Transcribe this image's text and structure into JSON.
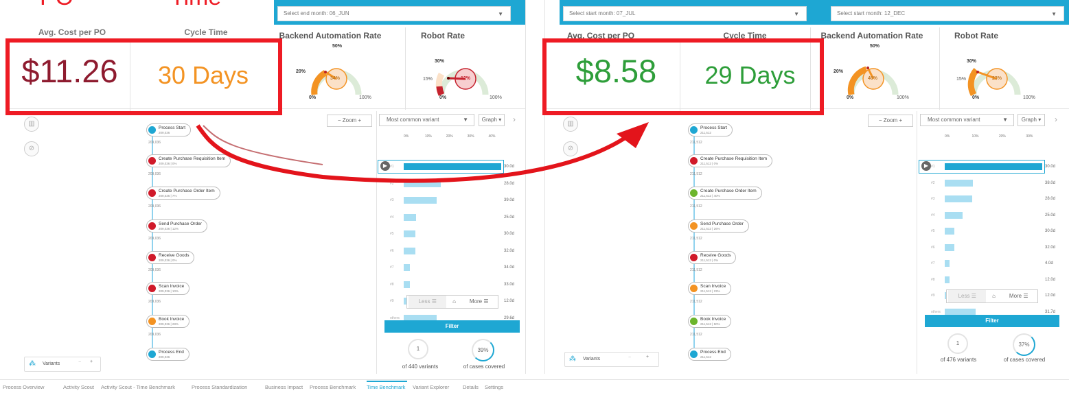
{
  "title_fragment": {
    "left": "PO",
    "right": "Time"
  },
  "left": {
    "select_label": "Select end month: 06_JUN",
    "kpi_partial": {
      "cost_header": "Avg. Cost per PO",
      "cycle_header": "Cycle Time"
    },
    "kpi": {
      "backend_header": "Backend Automation Rate",
      "robot_header": "Robot Rate",
      "avg_cost": "$11.26",
      "cycle_time": "30 Days"
    },
    "gauge_backend": {
      "value": "34%",
      "level": 0.34,
      "t0": "0%",
      "t20": "20%",
      "t50": "50%",
      "t100": "100%"
    },
    "gauge_robot": {
      "value": "12%",
      "level": 0.12,
      "t0": "0%",
      "t15": "15%",
      "t30": "30%",
      "t100": "100%"
    },
    "zoom": "Zoom",
    "variant_select": "Most common variant",
    "graph_btn": "Graph",
    "axis": [
      "0%",
      "10%",
      "20%",
      "30%",
      "40%"
    ],
    "bars": [
      {
        "label": "#1",
        "value": "30.0d",
        "frac": 1.0
      },
      {
        "label": "#2",
        "value": "28.0d",
        "frac": 0.38
      },
      {
        "label": "#3",
        "value": "39.0d",
        "frac": 0.34
      },
      {
        "label": "#4",
        "value": "25.0d",
        "frac": 0.13
      },
      {
        "label": "#5",
        "value": "30.0d",
        "frac": 0.12
      },
      {
        "label": "#6",
        "value": "32.0d",
        "frac": 0.12
      },
      {
        "label": "#7",
        "value": "34.0d",
        "frac": 0.06
      },
      {
        "label": "#8",
        "value": "33.0d",
        "frac": 0.06
      },
      {
        "label": "#9",
        "value": "12.0d",
        "frac": 0.06
      },
      {
        "label": "others",
        "value": "29.6d",
        "frac": 0.34
      }
    ],
    "less": "Less",
    "more": "More",
    "filter": "Filter",
    "variants_count": "1",
    "variants_caption": "of 440 variants",
    "cases_pct": "39%",
    "cases_caption": "of cases covered",
    "variants_btn": "Variants",
    "nodes": [
      {
        "label": "Process Start",
        "sub": "209,036",
        "color": "#1ea7d3"
      },
      {
        "label": "Create Purchase Requisition Item",
        "sub": "209,036 | 0%",
        "color": "#d01a2a"
      },
      {
        "label": "Create Purchase Order Item",
        "sub": "209,036 | 7%",
        "color": "#d01a2a"
      },
      {
        "label": "Send Purchase Order",
        "sub": "209,036 | 12%",
        "color": "#d01a2a"
      },
      {
        "label": "Receive Goods",
        "sub": "209,036 | 0%",
        "color": "#d01a2a"
      },
      {
        "label": "Scan Invoice",
        "sub": "209,036 | 10%",
        "color": "#d01a2a"
      },
      {
        "label": "Book Invoice",
        "sub": "209,036 | 28%",
        "color": "#f39323"
      },
      {
        "label": "Process End",
        "sub": "209,036",
        "color": "#1ea7d3"
      }
    ],
    "edge_count": "209,036"
  },
  "right": {
    "select1": "Select start month: 07_JUL",
    "select2": "Select start month: 12_DEC",
    "kpi": {
      "cost_header": "Avg. Cost per PO",
      "cycle_header": "Cycle Time",
      "backend_header": "Backend Automation Rate",
      "robot_header": "Robot Rate",
      "avg_cost": "$8.58",
      "cycle_time": "29 Days"
    },
    "gauge_backend": {
      "value": "40%",
      "level": 0.4,
      "t0": "0%",
      "t20": "20%",
      "t50": "50%",
      "t100": "100%"
    },
    "gauge_robot": {
      "value": "23%",
      "level": 0.23,
      "t0": "0%",
      "t15": "15%",
      "t30": "30%",
      "t100": "100%"
    },
    "zoom": "Zoom",
    "variant_select": "Most common variant",
    "graph_btn": "Graph",
    "axis": [
      "0%",
      "10%",
      "20%",
      "30%"
    ],
    "bars": [
      {
        "label": "#1",
        "value": "30.0d",
        "frac": 1.0
      },
      {
        "label": "#2",
        "value": "38.0d",
        "frac": 0.29
      },
      {
        "label": "#3",
        "value": "28.0d",
        "frac": 0.28
      },
      {
        "label": "#4",
        "value": "25.0d",
        "frac": 0.18
      },
      {
        "label": "#5",
        "value": "30.0d",
        "frac": 0.1
      },
      {
        "label": "#6",
        "value": "32.0d",
        "frac": 0.1
      },
      {
        "label": "#7",
        "value": "4.0d",
        "frac": 0.05
      },
      {
        "label": "#8",
        "value": "12.0d",
        "frac": 0.05
      },
      {
        "label": "#9",
        "value": "12.0d",
        "frac": 0.04
      },
      {
        "label": "others",
        "value": "31.7d",
        "frac": 0.32
      }
    ],
    "less": "Less",
    "more": "More",
    "filter": "Filter",
    "variants_count": "1",
    "variants_caption": "of 476 variants",
    "cases_pct": "37%",
    "cases_caption": "of cases covered",
    "variants_btn": "Variants",
    "nodes": [
      {
        "label": "Process Start",
        "sub": "211,512",
        "color": "#1ea7d3"
      },
      {
        "label": "Create Purchase Requisition Item",
        "sub": "211,512 | 0%",
        "color": "#d01a2a"
      },
      {
        "label": "Create Purchase Order Item",
        "sub": "211,512 | 40%",
        "color": "#6cb52d"
      },
      {
        "label": "Send Purchase Order",
        "sub": "211,512 | 26%",
        "color": "#f39323"
      },
      {
        "label": "Receive Goods",
        "sub": "211,512 | 0%",
        "color": "#d01a2a"
      },
      {
        "label": "Scan Invoice",
        "sub": "211,512 | 23%",
        "color": "#f39323"
      },
      {
        "label": "Book Invoice",
        "sub": "211,512 | 50%",
        "color": "#6cb52d"
      },
      {
        "label": "Process End",
        "sub": "211,512",
        "color": "#1ea7d3"
      }
    ],
    "edge_count": "211,512"
  },
  "nav": [
    "Process Overview",
    "Activity Scout",
    "Activity Scout - Time Benchmark",
    "Process Standardization",
    "Business Impact",
    "Process Benchmark",
    "Time Benchmark",
    "Variant Explorer",
    "Details",
    "Settings"
  ],
  "nav_active": "Time Benchmark",
  "colors": {
    "accent": "#1ea7d3",
    "highlight": "#ee1b24",
    "cost_bad": "#8e1b2f",
    "cycle_bad": "#f39323",
    "good": "#2e9e3a",
    "arrow": "#e3141b"
  }
}
